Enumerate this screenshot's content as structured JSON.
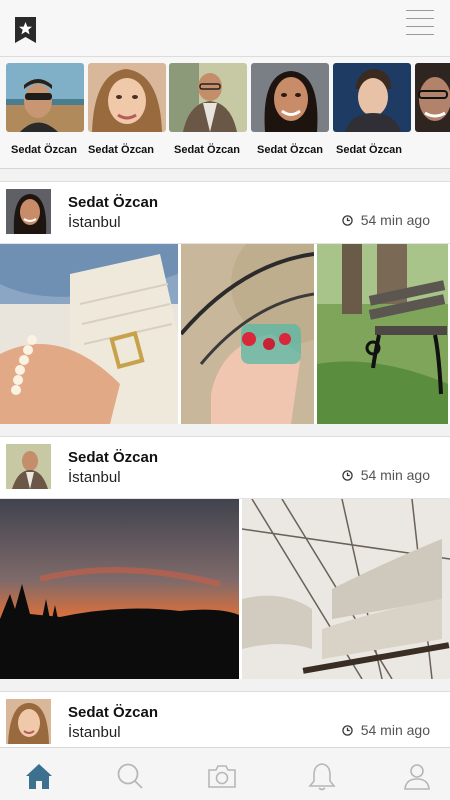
{
  "header": {
    "bookmark_icon": "star-bookmark-icon",
    "menu_icon": "hamburger-menu-icon"
  },
  "stories": [
    {
      "name": "Sedat Özcan",
      "photo": "man-sunglasses-beach"
    },
    {
      "name": "Sedat Özcan",
      "photo": "woman-smiling"
    },
    {
      "name": "Sedat Özcan",
      "photo": "man-glasses-vest"
    },
    {
      "name": "Sedat Özcan",
      "photo": "woman-dark-hair"
    },
    {
      "name": "Sedat Özcan",
      "photo": "young-man"
    },
    {
      "name": "",
      "photo": "woman-glasses"
    }
  ],
  "posts": [
    {
      "author": "Sedat Özcan",
      "location": "İstanbul",
      "time": "54 min ago",
      "photos": [
        "handbag-bracelet",
        "strawberries-bicycle",
        "park-bench"
      ]
    },
    {
      "author": "Sedat Özcan",
      "location": "İstanbul",
      "time": "54 min ago",
      "photos": [
        "sunset-silhouette",
        "sailing-ship-rigging"
      ]
    },
    {
      "author": "Sedat Özcan",
      "location": "İstanbul",
      "time": "54 min ago",
      "photos": []
    }
  ],
  "tabbar": {
    "items": [
      "home-icon",
      "search-icon",
      "camera-icon",
      "bell-icon",
      "profile-icon"
    ],
    "active": "home-icon",
    "active_color": "#3d6f8e",
    "inactive_color": "#b7b7b7"
  }
}
